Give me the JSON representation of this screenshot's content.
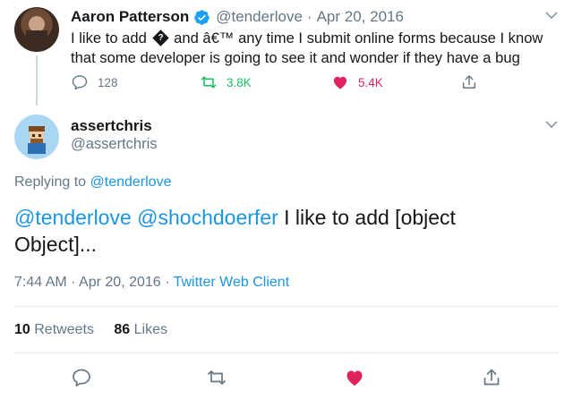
{
  "tweet": {
    "author_name": "Aaron Patterson",
    "author_handle": "@tenderlove",
    "separator": "·",
    "date": "Apr 20, 2016",
    "text_part1": "I like to add",
    "replacement_char": "?",
    "text_part2": "and â€™ any time I submit online forms because I know that some developer is going to see it and wonder if they have a bug",
    "replies": "128",
    "retweets": "3.8K",
    "likes": "5.4K"
  },
  "reply": {
    "author_name": "assertchris",
    "author_handle": "@assertchris",
    "replying_prefix": "Replying to",
    "replying_to": "@tenderlove",
    "mention1": "@tenderlove",
    "mention2": "@shochdoerfer",
    "text": "I like to add [object Object]...",
    "time": "7:44 AM",
    "date": "Apr 20, 2016",
    "client": "Twitter Web Client",
    "retweet_count": "10",
    "retweet_label": "Retweets",
    "like_count": "86",
    "like_label": "Likes"
  },
  "colors": {
    "link": "#1b95e0",
    "retweet_green": "#17bf63",
    "like_red": "#e0245e",
    "secondary_text": "#657786"
  },
  "icons": [
    "verified-icon",
    "chevron-down-icon",
    "reply-icon",
    "retweet-icon",
    "like-icon",
    "share-icon"
  ]
}
